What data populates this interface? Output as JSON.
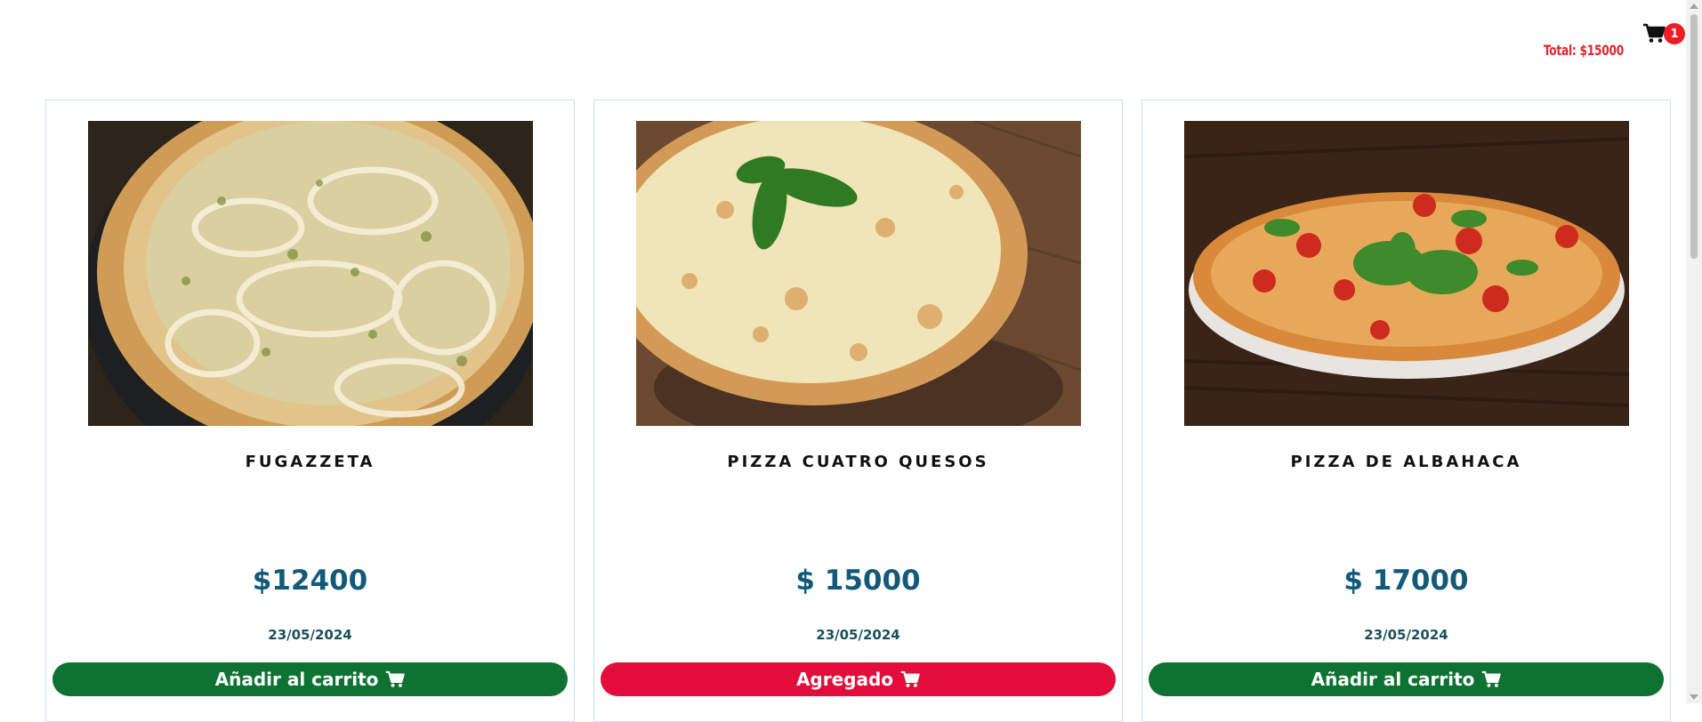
{
  "header": {
    "cart_icon": "shopping-cart-icon",
    "cart_count": "1",
    "cart_total": "Total: $15000",
    "accent_color": "#e2272d"
  },
  "products": [
    {
      "title": "FUGAZZETA",
      "price": "$12400",
      "date": "23/05/2024",
      "button_label": "Añadir al carrito",
      "button_state": "add",
      "button_color": "#0e7332"
    },
    {
      "title": "PIZZA CUATRO QUESOS",
      "price": "$ 15000",
      "date": "23/05/2024",
      "button_label": "Agregado",
      "button_state": "added",
      "button_color": "#e20d3a"
    },
    {
      "title": "PIZZA DE ALBAHACA",
      "price": "$ 17000",
      "date": "23/05/2024",
      "button_label": "Añadir al carrito",
      "button_state": "add",
      "button_color": "#0e7332"
    }
  ],
  "colors": {
    "price": "#135a78",
    "date": "#1b4f5d",
    "border": "#cfe0ea"
  }
}
